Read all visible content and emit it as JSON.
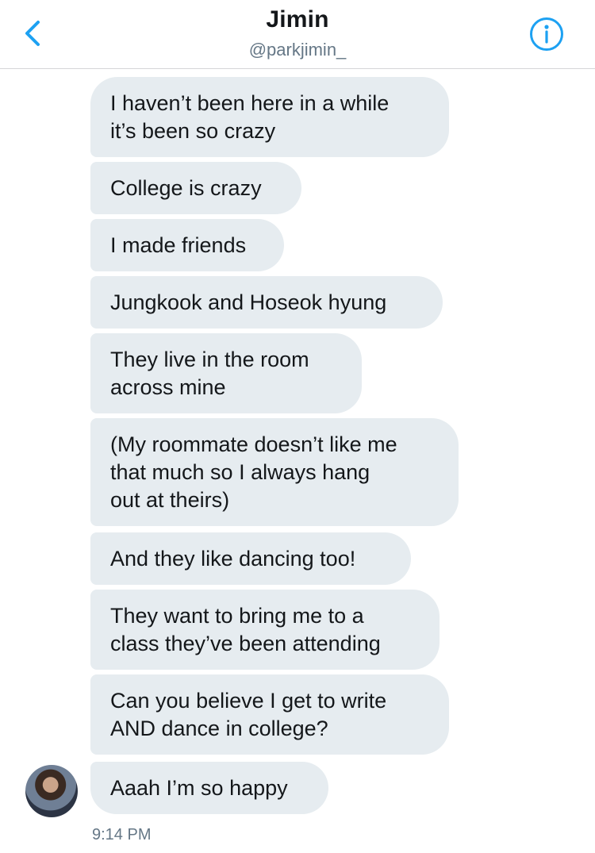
{
  "header": {
    "name": "Jimin",
    "handle": "@parkjimin_"
  },
  "icons": {
    "back": "chevron-left-icon",
    "info": "info-circle-icon"
  },
  "colors": {
    "accent": "#1da1f2",
    "bubble": "#e6ecf0",
    "secondary_text": "#657786"
  },
  "messages": [
    "I haven’t been here in a while\nit’s been so crazy",
    "College is crazy",
    "I made friends",
    "Jungkook and Hoseok hyung",
    "They live in the room\nacross mine",
    "(My roommate doesn’t like me\nthat much so I always hang\nout at theirs)",
    "And they like dancing too!",
    "They want to bring me to a\nclass they’ve been attending",
    "Can you believe I get to write\nAND dance in college?",
    "Aaah I’m so happy"
  ],
  "timestamp": "9:14 PM"
}
